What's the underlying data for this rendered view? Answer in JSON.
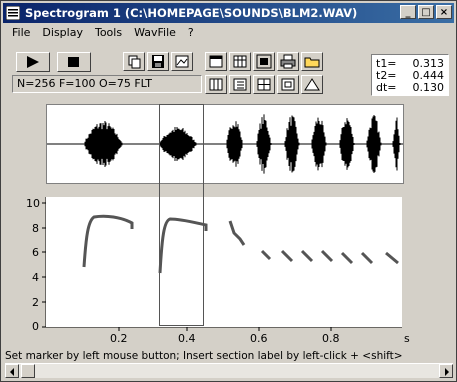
{
  "window": {
    "title": "Spectrogram 1 (C:\\HOMEPAGE\\SOUNDS\\BLM2.WAV)",
    "controls": [
      "_",
      "□",
      "×"
    ]
  },
  "menu": [
    "File",
    "Display",
    "Tools",
    "WavFile",
    "?"
  ],
  "toolbar": {
    "play_icon": "play-icon",
    "stop_icon": "stop-icon",
    "info": "N=256 F=100 O=75 FLT"
  },
  "times": [
    {
      "label": "t1=",
      "value": "0.313"
    },
    {
      "label": "t2=",
      "value": "0.444"
    },
    {
      "label": "dt=",
      "value": "0.130"
    }
  ],
  "spectrogram": {
    "y_ticks": [
      "10",
      "8",
      "6",
      "4",
      "2",
      "0"
    ],
    "x_ticks": [
      "0.2",
      "0.4",
      "0.6",
      "0.8"
    ],
    "x_unit": "s"
  },
  "status": "Set marker by left mouse button; Insert section label by left-click + <shift>",
  "colors": {
    "title_start": "#0a246a",
    "title_end": "#3a6ea5",
    "selection": "#606060"
  }
}
